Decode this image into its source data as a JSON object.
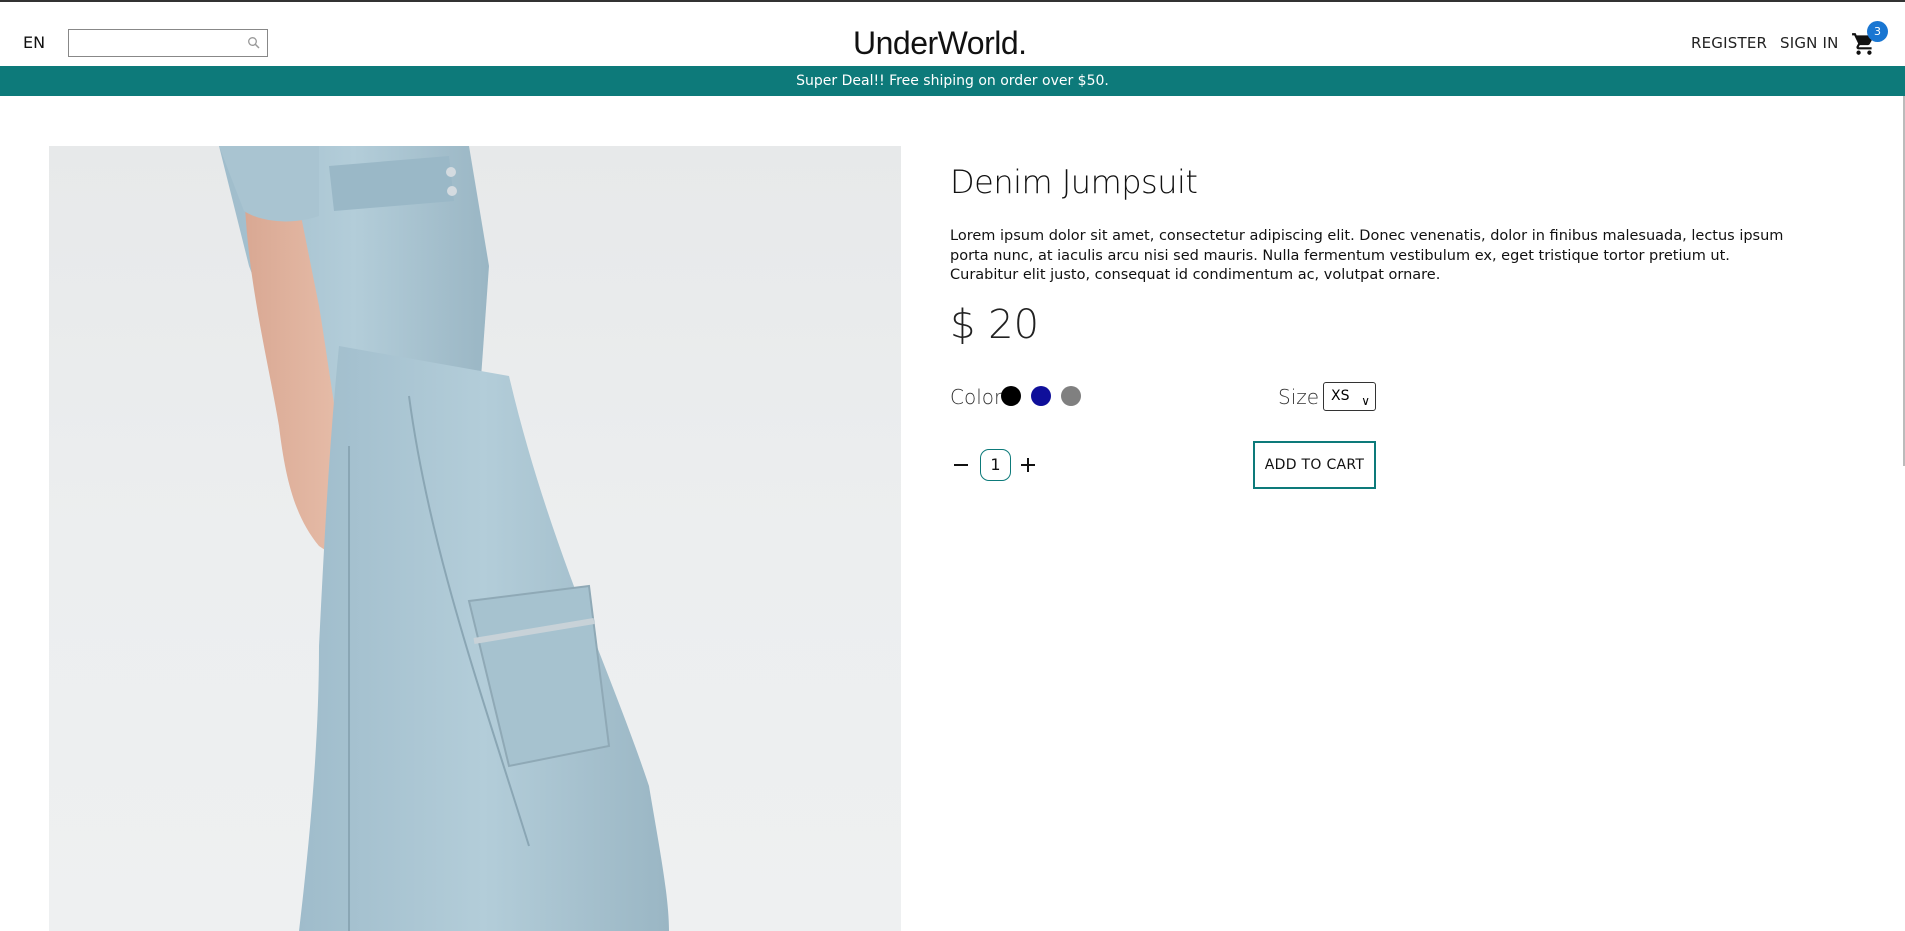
{
  "header": {
    "language": "EN",
    "search": {
      "value": "",
      "placeholder": ""
    },
    "logo": "UnderWorld.",
    "register": "REGISTER",
    "sign_in": "SIGN IN",
    "cart_count": "3"
  },
  "announcement": "Super Deal!! Free shiping on order over $50.",
  "product": {
    "title": "Denim Jumpsuit",
    "description": "Lorem ipsum dolor sit amet, consectetur adipiscing elit. Donec venenatis, dolor in finibus malesuada, lectus ipsum porta nunc, at iaculis arcu nisi sed mauris. Nulla fermentum vestibulum ex, eget tristique tortor pretium ut. Curabitur elit justo, consequat id condimentum ac, volutpat ornare.",
    "price": "$ 20",
    "color_label": "Color",
    "colors": [
      "#000000",
      "#0f0f9a",
      "#808080"
    ],
    "size_label": "Size",
    "size_selected": "XS",
    "quantity": "1",
    "add_to_cart": "ADD TO CART"
  },
  "theme": {
    "accent": "#0d7a7a",
    "badge": "#1976d2"
  }
}
